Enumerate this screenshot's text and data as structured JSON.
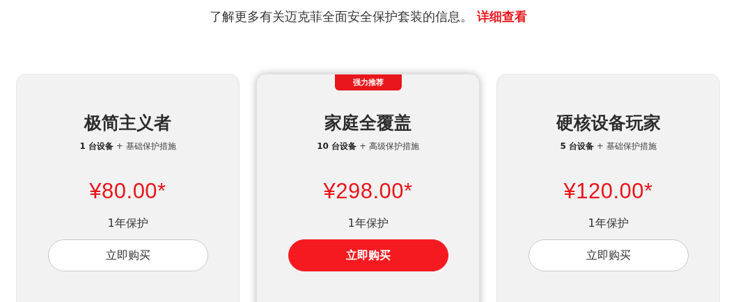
{
  "intro": {
    "text": "了解更多有关迈克菲全面安全保护套装的信息。",
    "link": "详细查看"
  },
  "plans": [
    {
      "name": "极简主义者",
      "devices": "**1 台设备** + 基础保护措施",
      "price": "¥80.00*",
      "term": "1年保护",
      "button": "立即购买",
      "featured": false
    },
    {
      "name": "家庭全覆盖",
      "badge": "强力推荐",
      "devices": "**10 台设备** + 高级保护措施",
      "price": "¥298.00*",
      "term": "1年保护",
      "button": "立即购买",
      "featured": true
    },
    {
      "name": "硬核设备玩家",
      "devices": "**5 台设备** + 基础保护措施",
      "price": "¥120.00*",
      "term": "1年保护",
      "button": "立即购买",
      "featured": false
    }
  ]
}
